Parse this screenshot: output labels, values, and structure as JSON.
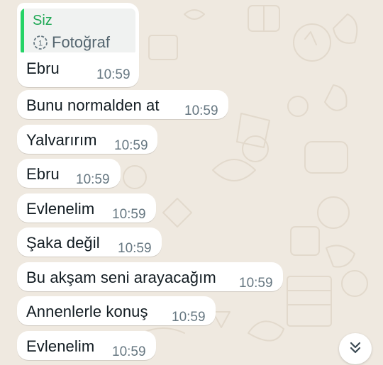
{
  "quoted_reply": {
    "author": "Siz",
    "media_label": "Fotoğraf",
    "icon": "view-once-icon"
  },
  "messages": [
    {
      "text": "Ebru",
      "time": "10:59"
    },
    {
      "text": "Bunu normalden at",
      "time": "10:59"
    },
    {
      "text": "Yalvarırım",
      "time": "10:59"
    },
    {
      "text": "Ebru",
      "time": "10:59"
    },
    {
      "text": "Evlenelim",
      "time": "10:59"
    },
    {
      "text": "Şaka değil",
      "time": "10:59"
    },
    {
      "text": "Bu akşam seni arayacağım",
      "time": "10:59"
    },
    {
      "text": "Annenlerle konuş",
      "time": "10:59"
    },
    {
      "text": "Evlenelim",
      "time": "10:59"
    }
  ],
  "scroll_button": {
    "icon": "double-chevron-down-icon"
  },
  "colors": {
    "background": "#efe9e0",
    "bubble": "#ffffff",
    "quote_accent": "#25d366",
    "quote_author": "#1fa855",
    "text": "#111b21",
    "time": "#667781"
  }
}
